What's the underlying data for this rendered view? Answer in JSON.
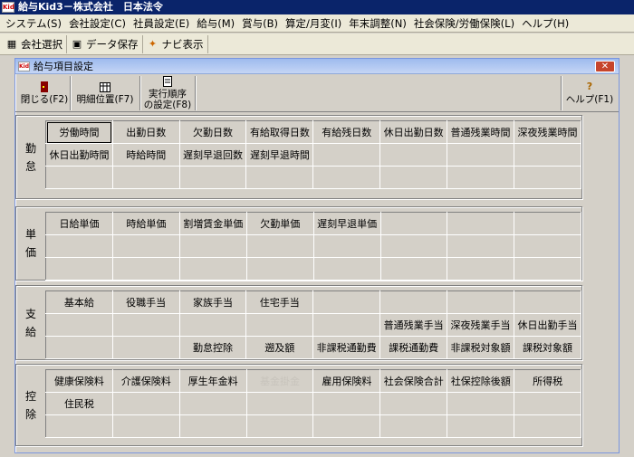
{
  "app": {
    "title": "給与Kid3－株式会社　日本法令",
    "icon": "kid-app-icon"
  },
  "menu": [
    "システム(S)",
    "会社設定(C)",
    "社員設定(E)",
    "給与(M)",
    "賞与(B)",
    "算定/月変(I)",
    "年末調整(N)",
    "社会保険/労働保険(L)",
    "ヘルプ(H)"
  ],
  "toolbar": [
    {
      "label": "会社選択",
      "icon": "company-icon"
    },
    {
      "label": "データ保存",
      "icon": "floppy-icon"
    },
    {
      "label": "ナビ表示",
      "icon": "navi-icon"
    }
  ],
  "window": {
    "title": "給与項目設定",
    "close": "✕",
    "buttons": {
      "close": "閉じる(F2)",
      "detail": "明細位置(F7)",
      "order_line1": "実行順序",
      "order_line2": "の設定(F8)",
      "help": "ヘルプ(F1)"
    }
  },
  "sections": [
    {
      "label": [
        "勤",
        "怠"
      ],
      "rows": [
        [
          "労働時間",
          "出勤日数",
          "欠勤日数",
          "有給取得日数",
          "有給残日数",
          "休日出勤日数",
          "普通残業時間",
          "深夜残業時間"
        ],
        [
          "休日出勤時間",
          "時給時間",
          "遅刻早退回数",
          "遅刻早退時間",
          "",
          "",
          "",
          ""
        ],
        [
          "",
          "",
          "",
          "",
          "",
          "",
          "",
          ""
        ]
      ]
    },
    {
      "label": [
        "単",
        "価"
      ],
      "rows": [
        [
          "日給単価",
          "時給単価",
          "割増賃金単価",
          "欠勤単価",
          "遅刻早退単価",
          "",
          "",
          ""
        ],
        [
          "",
          "",
          "",
          "",
          "",
          "",
          "",
          ""
        ],
        [
          "",
          "",
          "",
          "",
          "",
          "",
          "",
          ""
        ]
      ]
    },
    {
      "label": [
        "支",
        "給"
      ],
      "rows": [
        [
          "基本給",
          "役職手当",
          "家族手当",
          "住宅手当",
          "",
          "",
          "",
          ""
        ],
        [
          "",
          "",
          "",
          "",
          "",
          "普通残業手当",
          "深夜残業手当",
          "休日出勤手当"
        ],
        [
          "",
          "",
          "勤怠控除",
          "遡及額",
          "非課税通勤費",
          "課税通勤費",
          "非課税対象額",
          "課税対象額"
        ]
      ]
    },
    {
      "label": [
        "控",
        "除"
      ],
      "rows": [
        [
          "健康保険料",
          "介護保険料",
          "厚生年金料",
          "基金掛金",
          "雇用保険料",
          "社会保険合計",
          "社保控除後額",
          "所得税"
        ],
        [
          "住民税",
          "",
          "",
          "",
          "",
          "",
          "",
          ""
        ],
        [
          "",
          "",
          "",
          "",
          "",
          "",
          "",
          ""
        ]
      ]
    }
  ]
}
